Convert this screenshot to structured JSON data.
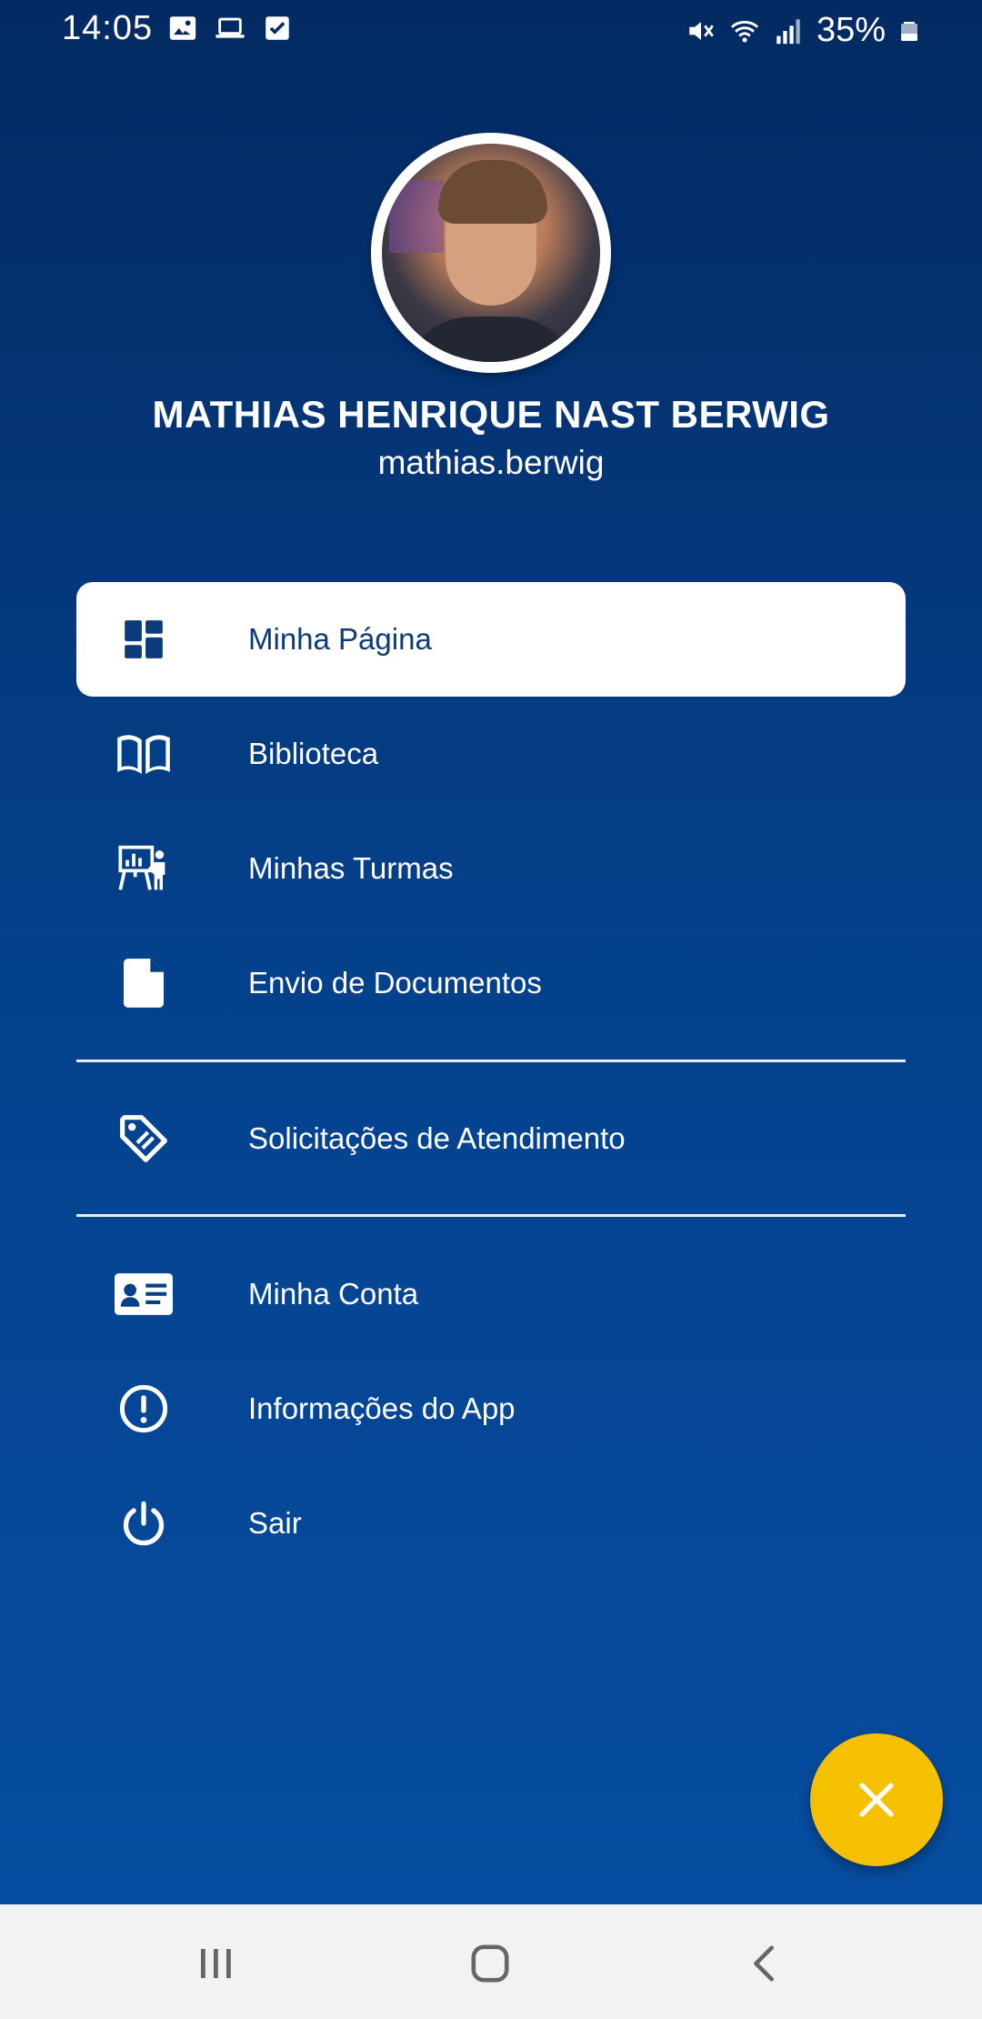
{
  "status_bar": {
    "time": "14:05",
    "battery": "35%",
    "icons_left": [
      "image-icon",
      "laptop-icon",
      "checkbox-icon"
    ],
    "icons_right": [
      "mute-icon",
      "wifi-icon",
      "signal-icon",
      "battery-icon"
    ]
  },
  "profile": {
    "name": "MATHIAS HENRIQUE NAST BERWIG",
    "username": "mathias.berwig"
  },
  "menu": {
    "items": [
      {
        "label": "Minha Página",
        "icon": "dashboard-icon",
        "active": true
      },
      {
        "label": "Biblioteca",
        "icon": "book-icon"
      },
      {
        "label": "Minhas Turmas",
        "icon": "classroom-icon"
      },
      {
        "label": "Envio de Documentos",
        "icon": "document-icon"
      },
      {
        "label": "Solicitações de Atendimento",
        "icon": "tag-icon"
      },
      {
        "label": "Minha Conta",
        "icon": "id-card-icon"
      },
      {
        "label": "Informações do App",
        "icon": "info-icon"
      },
      {
        "label": "Sair",
        "icon": "power-icon"
      }
    ]
  },
  "fab": {
    "icon": "close-icon"
  },
  "colors": {
    "background_top": "#032a62",
    "background_bottom": "#064fa4",
    "active_text": "#0b3b7a",
    "fab": "#f5c000"
  },
  "nav_bar": {
    "buttons": [
      "recents-icon",
      "home-icon",
      "back-icon"
    ]
  }
}
